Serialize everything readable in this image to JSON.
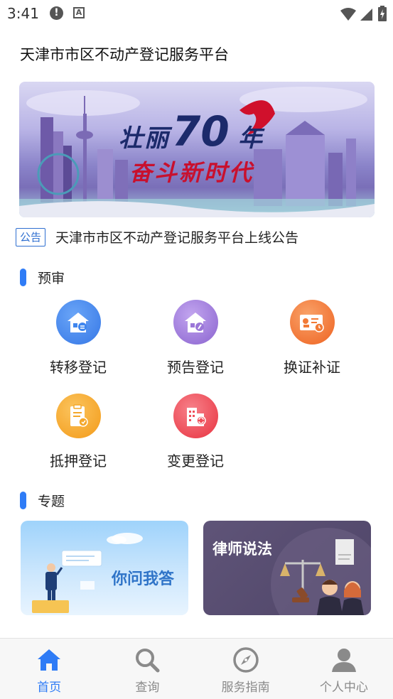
{
  "status_bar": {
    "time": "3:41",
    "icons": [
      "alert-icon",
      "a-icon",
      "wifi-icon",
      "signal-icon",
      "battery-icon"
    ]
  },
  "header": {
    "title": "天津市市区不动产登记服务平台"
  },
  "banner": {
    "line1": "壮丽",
    "number": "70",
    "line1_suffix": "年",
    "line2": "奋斗新时代"
  },
  "notice": {
    "tag": "公告",
    "text": "天津市市区不动产登记服务平台上线公告"
  },
  "sections": {
    "prereview": {
      "title": "预审",
      "items": [
        {
          "label": "转移登记",
          "icon": "house-transfer-icon",
          "color": "#3f86ee"
        },
        {
          "label": "预告登记",
          "icon": "house-notice-icon",
          "color": "#9b77d8"
        },
        {
          "label": "换证补证",
          "icon": "certificate-icon",
          "color": "#f27a36"
        },
        {
          "label": "抵押登记",
          "icon": "mortgage-document-icon",
          "color": "#f4a72a"
        },
        {
          "label": "变更登记",
          "icon": "building-change-icon",
          "color": "#ef4f5a"
        }
      ]
    },
    "topics": {
      "title": "专题",
      "cards": [
        {
          "title": "你问我答"
        },
        {
          "title": "律师说法"
        }
      ]
    }
  },
  "bottom_nav": {
    "items": [
      {
        "label": "首页",
        "icon": "home-icon",
        "active": true
      },
      {
        "label": "查询",
        "icon": "search-icon",
        "active": false
      },
      {
        "label": "服务指南",
        "icon": "compass-icon",
        "active": false
      },
      {
        "label": "个人中心",
        "icon": "user-icon",
        "active": false
      }
    ]
  },
  "colors": {
    "accent": "#2f7cf6",
    "nav_inactive": "#8a8a8a"
  }
}
